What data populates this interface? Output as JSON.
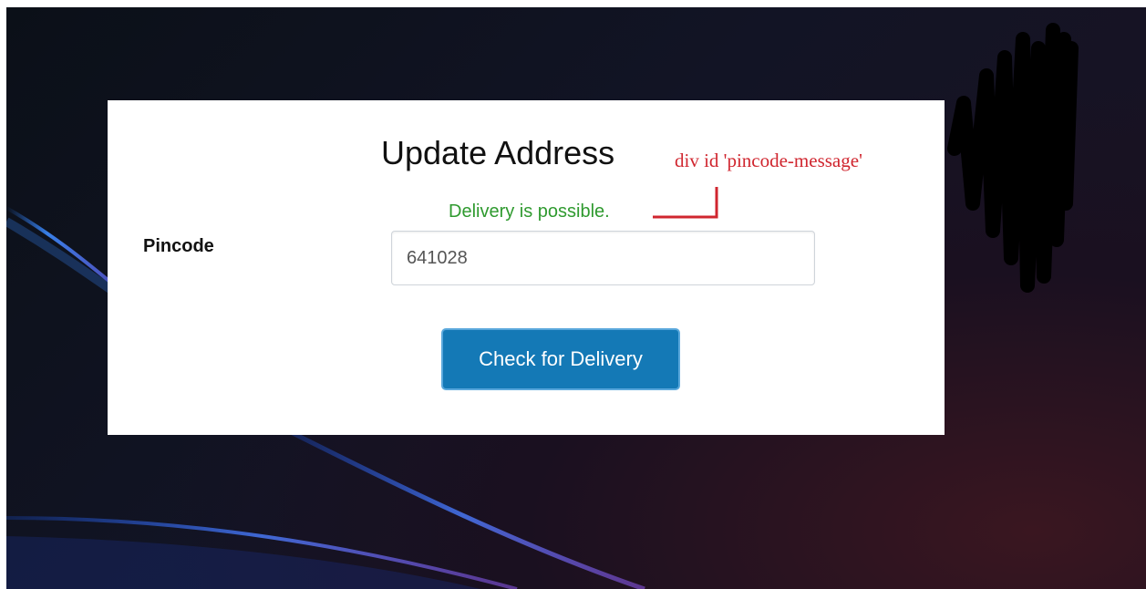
{
  "form": {
    "title": "Update Address",
    "message": "Delivery is possible.",
    "pincode_label": "Pincode",
    "pincode_value": "641028",
    "check_button_label": "Check for Delivery"
  },
  "annotation": {
    "text": "div id 'pincode-message'",
    "color": "#d0262f"
  },
  "colors": {
    "message": "#2f9a2f",
    "button": "#1479b6"
  }
}
